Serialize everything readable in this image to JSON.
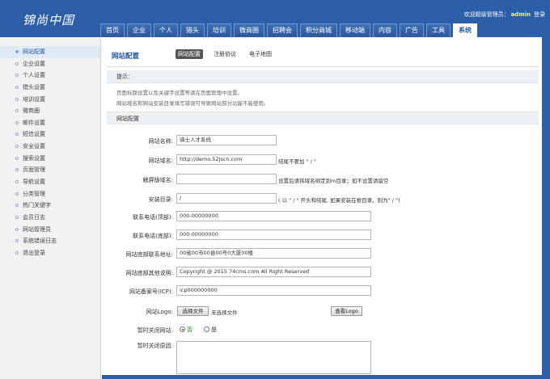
{
  "header": {
    "logo": "锦尚中国",
    "welcome": "欢迎超级管理员：",
    "username": "admin",
    "login": "登录"
  },
  "nav": [
    "首页",
    "企业",
    "个人",
    "猎头",
    "培训",
    "微商圈",
    "招聘会",
    "积分商城",
    "移动端",
    "内容",
    "广告",
    "工具",
    "系统"
  ],
  "nav_active": "系统",
  "sidebar": {
    "items": [
      "网站配置",
      "企业设置",
      "个人设置",
      "猎头设置",
      "培训设置",
      "微商圈",
      "邮件设置",
      "短信设置",
      "安全设置",
      "搜索设置",
      "页面管理",
      "导航设置",
      "分类管理",
      "热门关键字",
      "会员日志",
      "网站管理员",
      "系统错误日志",
      "退出登录"
    ],
    "active": "网站配置"
  },
  "page": {
    "title": "网站配置",
    "tabs": [
      "网站配置",
      "注册协议",
      "电子地图"
    ]
  },
  "tips": {
    "heading": "提示：",
    "line1": "页面标题设置以及关键字设置等请在页面管理中设置。",
    "line2": "网站域名和网站安装目录填写错误可导致网站部分功能不能使用。"
  },
  "section": {
    "heading": "网站配置"
  },
  "form": {
    "site_name": {
      "label": "网站名称:",
      "value": "骑士人才系统"
    },
    "site_domain": {
      "label": "网站域名:",
      "value": "http://demo.52jscn.com",
      "hint": "结尾不要加 \" / \""
    },
    "mobile_domain": {
      "label": "触屏版域名:",
      "value": "",
      "hint": "设置后请将域名绑定到m目录；如不设置请留空"
    },
    "install_dir": {
      "label": "安装目录:",
      "value": "/",
      "hint": "( 以 \" / \" 开头和结尾, 如果安装在根目录，则为\" / \")"
    },
    "phone_top": {
      "label": "联系电话(顶部):",
      "value": "000-00000000"
    },
    "phone_bottom": {
      "label": "联系电话(底部):",
      "value": "000-00000000"
    },
    "address": {
      "label": "网站底部联系地址:",
      "value": "00省00市00县00号0大厦00楼"
    },
    "footer_note": {
      "label": "网站底部其他说明:",
      "value": "Copyright @ 2015 74cms.com All Right Reserved"
    },
    "icp": {
      "label": "网站备案号(ICP):",
      "value": "icp000000000"
    },
    "logo": {
      "label": "网站Logo:",
      "choose": "选择文件",
      "status": "未选择文件",
      "view": "查看Logo"
    },
    "close_site": {
      "label": "暂时关闭网站:",
      "no": "否",
      "yes": "是",
      "selected": "否"
    },
    "close_reason": {
      "label": "暂时关闭原因:"
    }
  }
}
